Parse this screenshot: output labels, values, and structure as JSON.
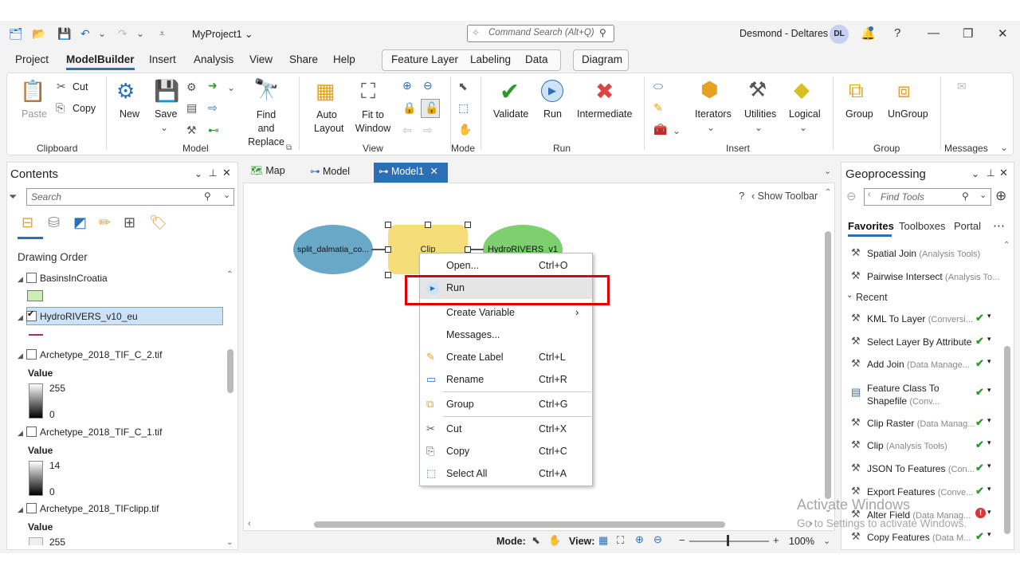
{
  "titlebar": {
    "project": "MyProject1 ⌄",
    "command_search_placeholder": "Command Search (Alt+Q)",
    "user": "Desmond - Deltares",
    "avatar": "DL",
    "help": "?"
  },
  "menu": {
    "tabs": [
      "Project",
      "ModelBuilder",
      "Insert",
      "Analysis",
      "View",
      "Share",
      "Help"
    ],
    "feature_layer_tabs": [
      "Feature Layer",
      "Labeling",
      "Data"
    ],
    "diagram_tab": "Diagram"
  },
  "ribbon": {
    "clipboard": {
      "paste": "Paste",
      "cut": "Cut",
      "copy": "Copy",
      "group": "Clipboard"
    },
    "model": {
      "new": "New",
      "save": "Save",
      "find_replace": "Find and Replace",
      "group": "Model"
    },
    "view": {
      "auto_layout": "Auto Layout",
      "fit_window": "Fit to Window",
      "group": "View"
    },
    "mode": {
      "group": "Mode"
    },
    "run": {
      "validate": "Validate",
      "run": "Run",
      "intermediate": "Intermediate",
      "group": "Run"
    },
    "insert": {
      "iterators": "Iterators",
      "utilities": "Utilities",
      "logical": "Logical",
      "group": "Insert"
    },
    "group": {
      "group_btn": "Group",
      "ungroup": "UnGroup",
      "group": "Group"
    },
    "messages": {
      "group": "Messages"
    }
  },
  "contents": {
    "title": "Contents",
    "search_placeholder": "Search",
    "drawing_order": "Drawing Order",
    "layers": [
      {
        "name": "BasinsInCroatia",
        "checked": false
      },
      {
        "name": "HydroRIVERS_v10_eu",
        "checked": true
      },
      {
        "name": "Archetype_2018_TIF_C_2.tif",
        "checked": false,
        "value_label": "Value",
        "max": "255",
        "min": "0"
      },
      {
        "name": "Archetype_2018_TIF_C_1.tif",
        "checked": false,
        "value_label": "Value",
        "max": "14",
        "min": "0"
      },
      {
        "name": "Archetype_2018_TIFclipp.tif",
        "checked": false,
        "value_label": "Value",
        "max": "255"
      }
    ]
  },
  "view_tabs": [
    "Map",
    "Model",
    "Model1"
  ],
  "canvas": {
    "show_toolbar": "Show Toolbar",
    "nodes": {
      "input": "split_dalmatia_co...",
      "tool": "Clip",
      "output": "HydroRIVERS_v1"
    }
  },
  "context_menu": {
    "items": [
      {
        "label": "Open...",
        "shortcut": "Ctrl+O",
        "icon": ""
      },
      {
        "label": "Run",
        "shortcut": "",
        "icon": "run-icon"
      },
      {
        "label": "Create Variable",
        "shortcut": "",
        "icon": "",
        "submenu": true
      },
      {
        "label": "Messages...",
        "shortcut": "",
        "icon": ""
      },
      {
        "label": "Create Label",
        "shortcut": "Ctrl+L",
        "icon": "label-icon"
      },
      {
        "label": "Rename",
        "shortcut": "Ctrl+R",
        "icon": "rename-icon"
      },
      {
        "label": "Group",
        "shortcut": "Ctrl+G",
        "icon": "group-icon"
      },
      {
        "label": "Cut",
        "shortcut": "Ctrl+X",
        "icon": "cut-icon"
      },
      {
        "label": "Copy",
        "shortcut": "Ctrl+C",
        "icon": "copy-icon"
      },
      {
        "label": "Select All",
        "shortcut": "Ctrl+A",
        "icon": "select-all-icon"
      }
    ]
  },
  "statusbar": {
    "mode_label": "Mode:",
    "view_label": "View:",
    "zoom": "100%"
  },
  "geoprocessing": {
    "title": "Geoprocessing",
    "search_placeholder": "Find Tools",
    "tabs": [
      "Favorites",
      "Toolboxes",
      "Portal"
    ],
    "favorites": [
      {
        "name": "Spatial Join",
        "sub": "(Analysis Tools)"
      },
      {
        "name": "Pairwise Intersect",
        "sub": "(Analysis To..."
      }
    ],
    "recent_label": "Recent",
    "recent": [
      {
        "name": "KML To Layer",
        "sub": "(Conversi...",
        "status": "ok"
      },
      {
        "name": "Select Layer By Attribute",
        "sub": "",
        "status": "ok"
      },
      {
        "name": "Add Join",
        "sub": "(Data Manage...",
        "status": "ok"
      },
      {
        "name": "Feature Class To Shapefile",
        "sub": "(Conv...",
        "status": "ok"
      },
      {
        "name": "Clip Raster",
        "sub": "(Data Manag...",
        "status": "ok"
      },
      {
        "name": "Clip",
        "sub": "(Analysis Tools)",
        "status": "ok"
      },
      {
        "name": "JSON To Features",
        "sub": "(Con...",
        "status": "ok"
      },
      {
        "name": "Export Features",
        "sub": "(Conve...",
        "status": "ok"
      },
      {
        "name": "Alter Field",
        "sub": "(Data Manag...",
        "status": "error"
      },
      {
        "name": "Copy Features",
        "sub": "(Data M...",
        "status": "ok"
      }
    ]
  },
  "watermark": {
    "line1": "Activate Windows",
    "line2": "Go to Settings to activate Windows."
  },
  "colors": {
    "accent": "#2d6fb6",
    "input_node": "#6aa8c8",
    "tool_node": "#f5de7a",
    "output_node": "#7dcf6f",
    "highlight": "#e00000"
  }
}
